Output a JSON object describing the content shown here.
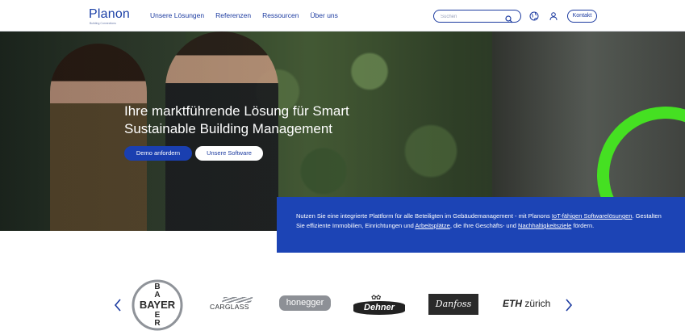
{
  "header": {
    "logo_text": "Planon",
    "logo_tagline": "Building Connections",
    "nav": [
      {
        "label": "Unsere Lösungen"
      },
      {
        "label": "Referenzen"
      },
      {
        "label": "Ressourcen"
      },
      {
        "label": "Über uns"
      }
    ],
    "search": {
      "placeholder": "Suchen",
      "value": ""
    },
    "contact_label": "Kontakt",
    "icons": [
      "search-icon",
      "globe-icon",
      "user-icon"
    ]
  },
  "hero": {
    "title": "Ihre marktführende Lösung für Smart Sustainable Building Management",
    "demo_label": "Demo anfordern",
    "software_label": "Unsere Software",
    "info": {
      "part1": "Nutzen Sie eine integrierte Plattform für alle Beteiligten im Gebäudemanagement - mit Planons ",
      "link1": "IoT-fähigen Softwarelösungen",
      "part2": ". Gestalten Sie effiziente Immobilien, Einrichtungen und ",
      "link2": "Arbeitsplätze",
      "part3": ", die Ihre Geschäfts- und ",
      "link3": "Nachhaltigkeitsziele",
      "part4": " fördern."
    }
  },
  "logos": {
    "items": [
      {
        "name": "BAYER",
        "text": "BAYER"
      },
      {
        "name": "CARGLASS",
        "text": "CARGLASS"
      },
      {
        "name": "honegger",
        "text": "honegger"
      },
      {
        "name": "Dehner",
        "text": "Dehner"
      },
      {
        "name": "Danfoss",
        "text": "Danfoss"
      },
      {
        "name": "ETH zürich",
        "text_bold": "ETH",
        "text_rest": "zürich"
      }
    ]
  },
  "colors": {
    "brand_blue": "#1c3ba0",
    "info_blue": "#1c44b5",
    "accent_green": "#45e022"
  }
}
